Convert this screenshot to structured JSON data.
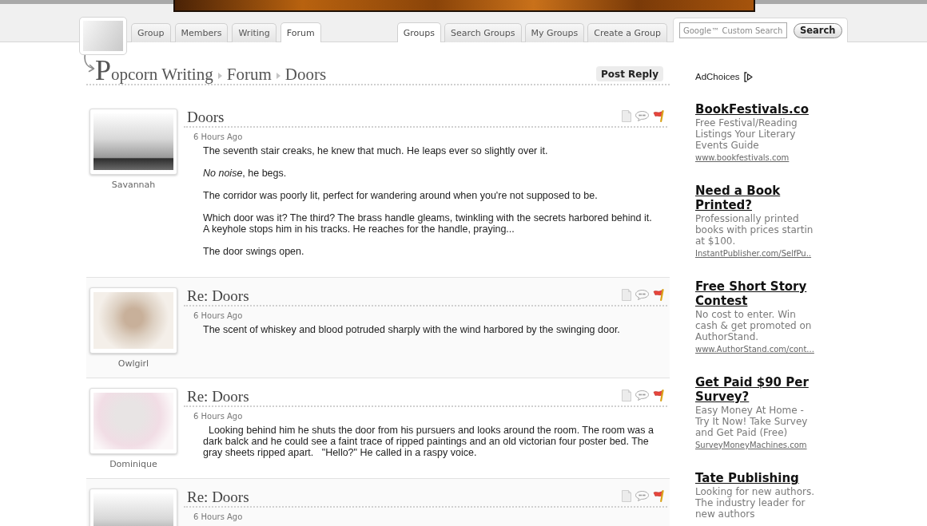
{
  "header": {
    "group_tabs": [
      {
        "label": "Group",
        "selected": false
      },
      {
        "label": "Members",
        "selected": false
      },
      {
        "label": "Writing",
        "selected": false
      },
      {
        "label": "Forum",
        "selected": true
      }
    ],
    "site_tabs": [
      {
        "label": "Groups",
        "selected": true
      },
      {
        "label": "Search Groups",
        "selected": false
      },
      {
        "label": "My Groups",
        "selected": false
      },
      {
        "label": "Create a Group",
        "selected": false
      }
    ],
    "search": {
      "placeholder": "Google™ Custom Search",
      "button": "Search"
    }
  },
  "breadcrumb": {
    "items": [
      "Popcorn Writing",
      "Forum",
      "Doors"
    ],
    "action": "Post Reply"
  },
  "posts": [
    {
      "author": "Savannah",
      "title": "Doors",
      "time": "6 Hours Ago",
      "paragraphs": [
        "The seventh stair creaks, he knew that much. He leaps ever so slightly over it.",
        "*No noise*, he begs.",
        "The corridor was poorly lit, perfect for wandering around when you're not supposed to be.",
        "Which door was it? The third? The brass handle gleams, twinkling with the secrets harbored behind it. A keyhole stops him in his tracks. He reaches for the handle, praying...",
        "The door swings open."
      ]
    },
    {
      "author": "Owlgirl",
      "title": "Re: Doors",
      "time": "6 Hours Ago",
      "paragraphs": [
        "The scent of whiskey and blood potruded sharply with the wind harbored by the swinging door."
      ]
    },
    {
      "author": "Dominique",
      "title": "Re: Doors",
      "time": "6 Hours Ago",
      "paragraphs": [
        "  Looking behind him he shuts the door from his pursuers and looks around the room. The room was a dark balck and he could see a faint trace of ripped paintings and an old victorian four poster bed. The gray sheets ripped apart.   \"Hello?\" He called in a raspy voice."
      ]
    },
    {
      "title": "Re: Doors",
      "time": "6 Hours Ago"
    }
  ],
  "sidebar": {
    "adchoices": "AdChoices",
    "ads": [
      {
        "title": "BookFestivals.co",
        "lines": [
          "Free Festival/Reading",
          "Listings Your Literary",
          "Events Guide"
        ],
        "url": "www.bookfestivals.com"
      },
      {
        "title": "Need a Book Printed?",
        "lines": [
          "Professionally printed",
          "books with prices startin",
          "at $100."
        ],
        "url": "InstantPublisher.com/SelfPu.."
      },
      {
        "title": "Free Short Story Contest",
        "lines": [
          "No cost to enter. Win",
          "cash & get promoted on",
          "AuthorStand."
        ],
        "url": "www.AuthorStand.com/cont..."
      },
      {
        "title": "Get Paid $90 Per Survey?",
        "lines": [
          "Easy Money At Home -",
          "Try It Now! Take Survey",
          "and Get Paid (Free)"
        ],
        "url": "SurveyMoneyMachines.com"
      },
      {
        "title": "Tate Publishing",
        "lines": [
          "Looking for new authors.",
          "The industry leader for",
          "new authors"
        ]
      }
    ]
  }
}
